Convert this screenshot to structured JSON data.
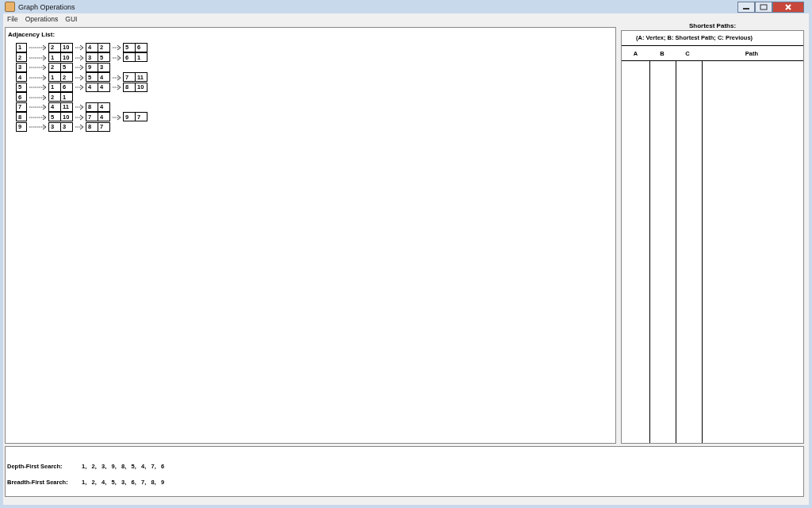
{
  "window": {
    "title": "Graph Operations"
  },
  "menu": [
    "File",
    "Operations",
    "GUI"
  ],
  "adjacency": {
    "title": "Adjacency List:",
    "rows": [
      {
        "vertex": "1",
        "edges": [
          [
            "2",
            "10"
          ],
          [
            "4",
            "2"
          ],
          [
            "5",
            "6"
          ]
        ]
      },
      {
        "vertex": "2",
        "edges": [
          [
            "1",
            "10"
          ],
          [
            "3",
            "5"
          ],
          [
            "6",
            "1"
          ]
        ]
      },
      {
        "vertex": "3",
        "edges": [
          [
            "2",
            "5"
          ],
          [
            "9",
            "3"
          ]
        ]
      },
      {
        "vertex": "4",
        "edges": [
          [
            "1",
            "2"
          ],
          [
            "5",
            "4"
          ],
          [
            "7",
            "11"
          ]
        ]
      },
      {
        "vertex": "5",
        "edges": [
          [
            "1",
            "6"
          ],
          [
            "4",
            "4"
          ],
          [
            "8",
            "10"
          ]
        ]
      },
      {
        "vertex": "6",
        "edges": [
          [
            "2",
            "1"
          ]
        ]
      },
      {
        "vertex": "7",
        "edges": [
          [
            "4",
            "11"
          ],
          [
            "8",
            "4"
          ]
        ]
      },
      {
        "vertex": "8",
        "edges": [
          [
            "5",
            "10"
          ],
          [
            "7",
            "4"
          ],
          [
            "9",
            "7"
          ]
        ]
      },
      {
        "vertex": "9",
        "edges": [
          [
            "3",
            "3"
          ],
          [
            "8",
            "7"
          ]
        ]
      }
    ]
  },
  "shortest_paths": {
    "title": "Shortest Paths:",
    "legend": "(A: Vertex;  B: Shortest Path;  C: Previous)",
    "columns": [
      "A",
      "B",
      "C",
      "Path"
    ]
  },
  "traversals": [
    {
      "label": "Depth-First Search:",
      "order": [
        "1,",
        "2,",
        "3,",
        "9,",
        "8,",
        "5,",
        "4,",
        "7,",
        "6"
      ]
    },
    {
      "label": "Breadth-First Search:",
      "order": [
        "1,",
        "2,",
        "4,",
        "5,",
        "3,",
        "6,",
        "7,",
        "8,",
        "9"
      ]
    }
  ]
}
